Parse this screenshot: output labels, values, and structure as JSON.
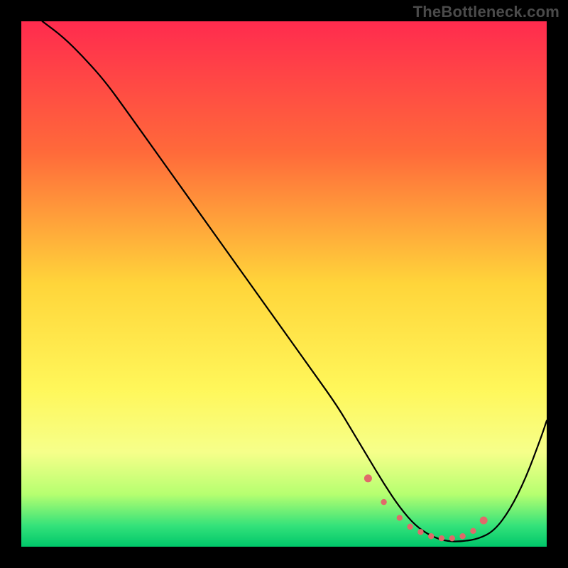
{
  "watermark": "TheBottleneck.com",
  "chart_data": {
    "type": "line",
    "title": "",
    "xlabel": "",
    "ylabel": "",
    "xlim": [
      0,
      100
    ],
    "ylim": [
      0,
      100
    ],
    "grid": false,
    "legend": false,
    "background_gradient": {
      "stops": [
        {
          "offset": 0.0,
          "color": "#ff2b4e"
        },
        {
          "offset": 0.25,
          "color": "#ff6a3a"
        },
        {
          "offset": 0.5,
          "color": "#ffd53a"
        },
        {
          "offset": 0.7,
          "color": "#fff75a"
        },
        {
          "offset": 0.82,
          "color": "#f6ff8a"
        },
        {
          "offset": 0.9,
          "color": "#b6ff70"
        },
        {
          "offset": 0.96,
          "color": "#34e27a"
        },
        {
          "offset": 1.0,
          "color": "#00c76a"
        }
      ]
    },
    "series": [
      {
        "name": "bottleneck-curve",
        "color": "#000000",
        "type": "line",
        "x": [
          4,
          8,
          12,
          16,
          20,
          25,
          30,
          35,
          40,
          45,
          50,
          55,
          60,
          63,
          66,
          69,
          72,
          75,
          78,
          81,
          84,
          87,
          90,
          93,
          96,
          99,
          100
        ],
        "y": [
          100,
          97,
          93,
          88.5,
          83,
          76,
          69,
          62,
          55,
          48,
          41,
          34,
          27,
          22,
          17,
          12,
          7.5,
          4,
          2,
          1,
          1,
          1.5,
          3,
          7,
          13,
          21,
          24
        ]
      },
      {
        "name": "trough-markers",
        "color": "#e06a6a",
        "type": "scatter",
        "x": [
          66,
          69,
          72,
          74,
          76,
          78,
          80,
          82,
          84,
          86,
          88
        ],
        "y": [
          13,
          8.5,
          5.5,
          3.8,
          2.8,
          2,
          1.6,
          1.6,
          2,
          3,
          5
        ]
      }
    ]
  }
}
